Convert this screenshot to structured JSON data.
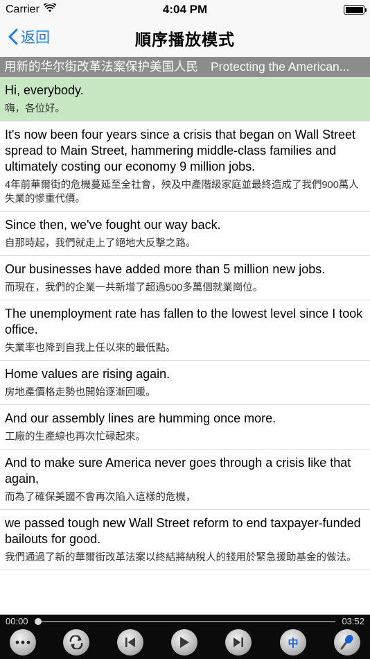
{
  "status_bar": {
    "carrier": "Carrier",
    "time": "4:04 PM",
    "battery_level": 1.0
  },
  "nav": {
    "back_label": "返回",
    "title": "順序播放模式",
    "accent": "#1a7cf5"
  },
  "ticker": {
    "zh_title": "用新的华尔街改革法案保护美国人民",
    "en_title": "Protecting the American..."
  },
  "sentences": [
    {
      "en": "Hi, everybody.",
      "zh": "嗨，各位好。",
      "active": true
    },
    {
      "en": "It's now been four years since a crisis that began on Wall Street spread to Main Street, hammering middle-class families and ultimately costing our economy 9 million jobs.",
      "zh": "4年前華爾街的危機蔓延至全社會，殃及中產階級家庭並最終造成了我們900萬人失業的慘重代價。"
    },
    {
      "en": "Since then, we've fought our way back.",
      "zh": "自那時起，我們就走上了絕地大反擊之路。"
    },
    {
      "en": "Our businesses have added more than 5 million new jobs.",
      "zh": "而現在，我們的企業一共新增了超過500多萬個就業崗位。"
    },
    {
      "en": "The unemployment rate has fallen to the lowest level since I took office.",
      "zh": "失業率也降到自我上任以來的最低點。"
    },
    {
      "en": "Home values are rising again.",
      "zh": "房地產價格走勢也開始逐漸回暖。"
    },
    {
      "en": "And our assembly lines are humming once more.",
      "zh": "工廠的生產線也再次忙碌起來。"
    },
    {
      "en": "And to make sure America never goes through a crisis like that again,",
      "zh": "而為了確保美國不會再次陷入這樣的危機，"
    },
    {
      "en": "we passed tough new Wall Street reform to end taxpayer-funded bailouts for good.",
      "zh": "我們通過了新的華爾街改革法案以終結將納稅人的錢用於緊急援助基金的做法。"
    }
  ],
  "player": {
    "current_time": "00:00",
    "total_time": "03:52",
    "progress": 0.0,
    "controls": [
      {
        "name": "more-button",
        "icon": "ellipsis-icon"
      },
      {
        "name": "repeat-mode-button",
        "icon": "repeat-icon"
      },
      {
        "name": "previous-button",
        "icon": "skip-back-icon"
      },
      {
        "name": "play-button",
        "icon": "play-icon"
      },
      {
        "name": "next-button",
        "icon": "skip-forward-icon"
      },
      {
        "name": "chinese-toggle-button",
        "icon": "chinese-char-icon",
        "label": "中"
      },
      {
        "name": "record-button",
        "icon": "microphone-icon"
      }
    ]
  }
}
